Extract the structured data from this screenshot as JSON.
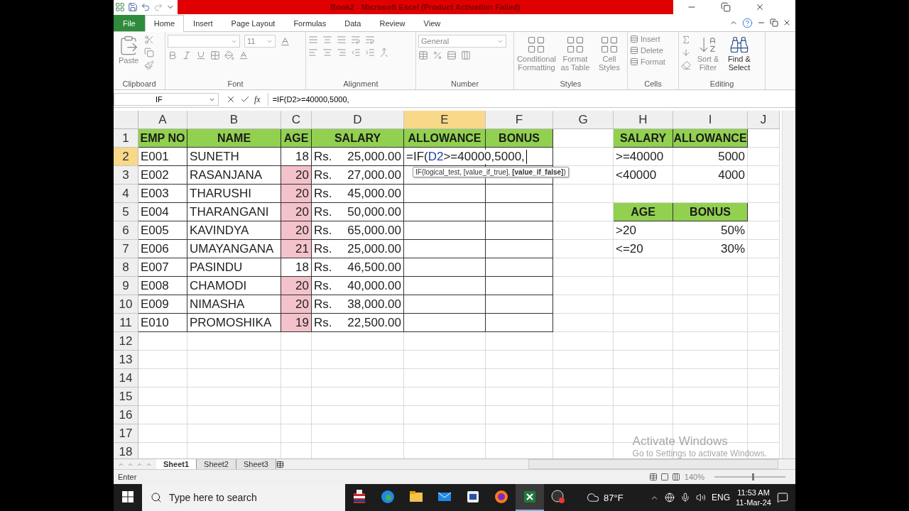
{
  "window": {
    "title": "Book2 - Microsoft Excel (Product Activation Failed)"
  },
  "tabs": [
    {
      "label": "File",
      "selected": false,
      "kind": "file"
    },
    {
      "label": "Home",
      "selected": true
    },
    {
      "label": "Insert",
      "selected": false
    },
    {
      "label": "Page Layout",
      "selected": false
    },
    {
      "label": "Formulas",
      "selected": false
    },
    {
      "label": "Data",
      "selected": false
    },
    {
      "label": "Review",
      "selected": false
    },
    {
      "label": "View",
      "selected": false
    }
  ],
  "ribbon": {
    "groups": [
      {
        "kind": "clipboard",
        "name": "Clipboard",
        "buttons": [
          "Paste"
        ]
      },
      {
        "kind": "font",
        "name": "Font",
        "font_size": "11"
      },
      {
        "kind": "alignment",
        "name": "Alignment"
      },
      {
        "kind": "number",
        "name": "Number",
        "format": "General"
      },
      {
        "kind": "styles",
        "name": "Styles",
        "buttons": [
          "Conditional Formatting",
          "Format as Table",
          "Cell Styles"
        ]
      },
      {
        "kind": "cells",
        "name": "Cells",
        "buttons": [
          "Insert",
          "Delete",
          "Format"
        ]
      },
      {
        "kind": "editing",
        "name": "Editing",
        "buttons": [
          "Sort & Filter",
          "Find & Select"
        ]
      }
    ]
  },
  "formula_bar": {
    "name_box": "IF",
    "function_button": "fx",
    "formula": "=IF(D2>=40000,5000,"
  },
  "sheet": {
    "columns": [
      {
        "label": "A",
        "selected": false
      },
      {
        "label": "B",
        "selected": false
      },
      {
        "label": "C",
        "selected": false
      },
      {
        "label": "D",
        "selected": false
      },
      {
        "label": "E",
        "selected": true
      },
      {
        "label": "F",
        "selected": false
      },
      {
        "label": "G",
        "selected": false
      },
      {
        "label": "H",
        "selected": false
      },
      {
        "label": "I",
        "selected": false
      },
      {
        "label": "J",
        "selected": false
      }
    ],
    "rows": [
      {
        "label": "1",
        "selected": false,
        "cells": [
          {
            "kind": "header",
            "text": "EMP NO"
          },
          {
            "kind": "header",
            "text": "NAME"
          },
          {
            "kind": "header",
            "text": "AGE"
          },
          {
            "kind": "header",
            "text": "SALARY"
          },
          {
            "kind": "header",
            "text": "ALLOWANCE"
          },
          {
            "kind": "header",
            "text": "BONUS"
          },
          {},
          {
            "kind": "header",
            "text": "SALARY"
          },
          {
            "kind": "header",
            "text": "ALLOWANCE"
          }
        ]
      },
      {
        "label": "2",
        "selected": true,
        "framed": true,
        "cells": [
          {
            "kind": "text",
            "text": "E001"
          },
          {
            "kind": "text",
            "text": "SUNETH"
          },
          {
            "kind": "number",
            "text": "18",
            "highlight": false
          },
          {
            "kind": "currency",
            "symbol": "Rs.",
            "text": "25,000.00"
          },
          {
            "kind": "formula",
            "parts": [
              {
                "text": "=IF(",
                "ref": false
              },
              {
                "text": "D2",
                "ref": true
              },
              {
                "text": ">=40000,5000,",
                "ref": false
              }
            ],
            "tooltip": "IF(logical_test, [value_if_true], **[value_if_false]**)"
          },
          {},
          {},
          {
            "kind": "text",
            "text": ">=40000"
          },
          {
            "kind": "number",
            "text": "5000"
          }
        ]
      },
      {
        "label": "3",
        "selected": false,
        "framed": true,
        "cells": [
          {
            "kind": "text",
            "text": "E002"
          },
          {
            "kind": "text",
            "text": "RASANJANA"
          },
          {
            "kind": "number",
            "text": "20",
            "highlight": true
          },
          {
            "kind": "currency",
            "symbol": "Rs.",
            "text": "27,000.00"
          },
          {},
          {},
          {},
          {
            "kind": "text",
            "text": "<40000"
          },
          {
            "kind": "number",
            "text": "4000"
          }
        ]
      },
      {
        "label": "4",
        "selected": false,
        "framed": true,
        "cells": [
          {
            "kind": "text",
            "text": "E003"
          },
          {
            "kind": "text",
            "text": "THARUSHI"
          },
          {
            "kind": "number",
            "text": "20",
            "highlight": true
          },
          {
            "kind": "currency",
            "symbol": "Rs.",
            "text": "45,000.00"
          }
        ]
      },
      {
        "label": "5",
        "selected": false,
        "framed": true,
        "cells": [
          {
            "kind": "text",
            "text": "E004"
          },
          {
            "kind": "text",
            "text": "THARANGANI"
          },
          {
            "kind": "number",
            "text": "20",
            "highlight": true
          },
          {
            "kind": "currency",
            "symbol": "Rs.",
            "text": "50,000.00"
          },
          {},
          {},
          {},
          {
            "kind": "header",
            "text": "AGE"
          },
          {
            "kind": "header",
            "text": "BONUS"
          }
        ]
      },
      {
        "label": "6",
        "selected": false,
        "framed": true,
        "cells": [
          {
            "kind": "text",
            "text": "E005"
          },
          {
            "kind": "text",
            "text": "KAVINDYA"
          },
          {
            "kind": "number",
            "text": "20",
            "highlight": true
          },
          {
            "kind": "currency",
            "symbol": "Rs.",
            "text": "65,000.00"
          },
          {},
          {},
          {},
          {
            "kind": "text",
            "text": ">20"
          },
          {
            "kind": "number",
            "text": "50%"
          }
        ]
      },
      {
        "label": "7",
        "selected": false,
        "framed": true,
        "cells": [
          {
            "kind": "text",
            "text": "E006"
          },
          {
            "kind": "text",
            "text": "UMAYANGANA"
          },
          {
            "kind": "number",
            "text": "21",
            "highlight": true
          },
          {
            "kind": "currency",
            "symbol": "Rs.",
            "text": "25,000.00"
          },
          {},
          {},
          {},
          {
            "kind": "text",
            "text": "<=20"
          },
          {
            "kind": "number",
            "text": "30%"
          }
        ]
      },
      {
        "label": "8",
        "selected": false,
        "framed": true,
        "cells": [
          {
            "kind": "text",
            "text": "E007"
          },
          {
            "kind": "text",
            "text": "PASINDU"
          },
          {
            "kind": "number",
            "text": "18",
            "highlight": false
          },
          {
            "kind": "currency",
            "symbol": "Rs.",
            "text": "46,500.00"
          }
        ]
      },
      {
        "label": "9",
        "selected": false,
        "framed": true,
        "cells": [
          {
            "kind": "text",
            "text": "E008"
          },
          {
            "kind": "text",
            "text": "CHAMODI"
          },
          {
            "kind": "number",
            "text": "20",
            "highlight": true
          },
          {
            "kind": "currency",
            "symbol": "Rs.",
            "text": "40,000.00"
          }
        ]
      },
      {
        "label": "10",
        "selected": false,
        "framed": true,
        "cells": [
          {
            "kind": "text",
            "text": "E009"
          },
          {
            "kind": "text",
            "text": "NIMASHA"
          },
          {
            "kind": "number",
            "text": "20",
            "highlight": true
          },
          {
            "kind": "currency",
            "symbol": "Rs.",
            "text": "38,000.00"
          }
        ]
      },
      {
        "label": "11",
        "selected": false,
        "framed": true,
        "cells": [
          {
            "kind": "text",
            "text": "E010"
          },
          {
            "kind": "text",
            "text": "PROMOSHIKA"
          },
          {
            "kind": "number",
            "text": "19",
            "highlight": true
          },
          {
            "kind": "currency",
            "symbol": "Rs.",
            "text": "22,500.00"
          }
        ]
      },
      {
        "label": "12",
        "selected": false,
        "framed": false
      },
      {
        "label": "13",
        "selected": false,
        "framed": false
      },
      {
        "label": "14",
        "selected": false,
        "framed": false
      },
      {
        "label": "15",
        "selected": false,
        "framed": false
      },
      {
        "label": "16",
        "selected": false,
        "framed": false
      },
      {
        "label": "17",
        "selected": false,
        "framed": false
      },
      {
        "label": "18",
        "selected": false,
        "framed": false
      }
    ]
  },
  "activation_notice": {
    "title": "Activate Windows",
    "text": "Go to Settings to activate Windows."
  },
  "sheet_tabs": [
    {
      "label": "Sheet1",
      "selected": true
    },
    {
      "label": "Sheet2",
      "selected": false
    },
    {
      "label": "Sheet3",
      "selected": false
    }
  ],
  "status_bar": {
    "mode": "Enter",
    "zoom": "140%",
    "zoom_level": {
      "level": 0.53
    }
  },
  "taskbar": {
    "search_placeholder": "Type here to search",
    "apps": [
      {
        "kind": "ballot",
        "selected": false
      },
      {
        "kind": "browser",
        "selected": false
      },
      {
        "kind": "folder",
        "selected": false
      },
      {
        "kind": "mail",
        "selected": false
      },
      {
        "kind": "vb",
        "selected": false
      },
      {
        "kind": "fox",
        "selected": false
      },
      {
        "kind": "spreadsheet",
        "selected": true
      },
      {
        "kind": "recorder",
        "selected": false
      }
    ],
    "weather": "87°F",
    "language": "ENG",
    "time": "11:53 AM",
    "date": "11-Mar-24"
  }
}
